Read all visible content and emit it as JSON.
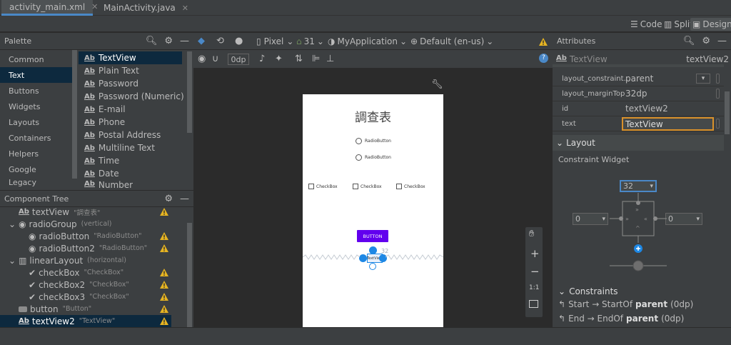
{
  "tabs": [
    {
      "label": "activity_main.xml",
      "icon": "xml-layout-icon",
      "active": true
    },
    {
      "label": "MainActivity.java",
      "icon": "java-class-icon",
      "active": false
    }
  ],
  "view_modes": {
    "code": "Code",
    "split": "Split",
    "design": "Design"
  },
  "palette": {
    "title": "Palette",
    "categories": [
      "Common",
      "Text",
      "Buttons",
      "Widgets",
      "Layouts",
      "Containers",
      "Helpers",
      "Google",
      "Legacy"
    ],
    "selected_category": "Text",
    "items": [
      "TextView",
      "Plain Text",
      "Password",
      "Password (Numeric)",
      "E-mail",
      "Phone",
      "Postal Address",
      "Multiline Text",
      "Time",
      "Date",
      "Number"
    ],
    "ab_glyph": "Ab"
  },
  "component_tree": {
    "title": "Component Tree",
    "rows": [
      {
        "name": "textView",
        "desc": "\"調查表\""
      },
      {
        "name": "radioGroup",
        "desc": "(vertical)"
      },
      {
        "name": "radioButton",
        "desc": "\"RadioButton\""
      },
      {
        "name": "radioButton2",
        "desc": "\"RadioButton\""
      },
      {
        "name": "linearLayout",
        "desc": "(horizontal)"
      },
      {
        "name": "checkBox",
        "desc": "\"CheckBox\""
      },
      {
        "name": "checkBox2",
        "desc": "\"CheckBox\""
      },
      {
        "name": "checkBox3",
        "desc": "\"CheckBox\""
      },
      {
        "name": "button",
        "desc": "\"Button\""
      },
      {
        "name": "textView2",
        "desc": "\"TextView\""
      }
    ]
  },
  "design_toolbar": {
    "device": "Pixel",
    "api": "31",
    "theme": "MyApplication",
    "locale": "Default (en-us)",
    "margin": "0dp"
  },
  "phone_preview": {
    "title": "調查表",
    "radio1": "RadioButton",
    "radio2": "RadioButton",
    "check1": "CheckBox",
    "check2": "CheckBox",
    "check3": "CheckBox",
    "button": "BUTTON",
    "margin_label": "32",
    "selected_text": "TextView"
  },
  "zoom_tools": {
    "zoom_in": "+",
    "zoom_out": "−",
    "one_to_one": "1:1"
  },
  "attributes": {
    "title": "Attributes",
    "component_type": "TextView",
    "component_id": "textView2",
    "rows": [
      {
        "key": "layout_constraint...",
        "value": "parent"
      },
      {
        "key": "layout_marginTop",
        "value": "32dp"
      },
      {
        "key": "id",
        "value": "textView2"
      },
      {
        "key": "text",
        "value": "TextView"
      }
    ],
    "layout_section": "Layout",
    "constraint_widget": "Constraint Widget",
    "top_margin": "32",
    "left_margin": "0",
    "right_margin": "0",
    "constraints_section": "Constraints",
    "constraint_rows": [
      {
        "prefix": "Start → StartOf ",
        "target": "parent",
        "suffix": " (0dp)"
      },
      {
        "prefix": "End → EndOf ",
        "target": "parent",
        "suffix": " (0dp)"
      }
    ]
  },
  "colors": {
    "accent_blue": "#4a88c7",
    "warning_yellow": "#e6b422",
    "selected_bg": "#0d293e",
    "button_purple": "#6200ee",
    "handle_blue": "#1e88e5"
  }
}
